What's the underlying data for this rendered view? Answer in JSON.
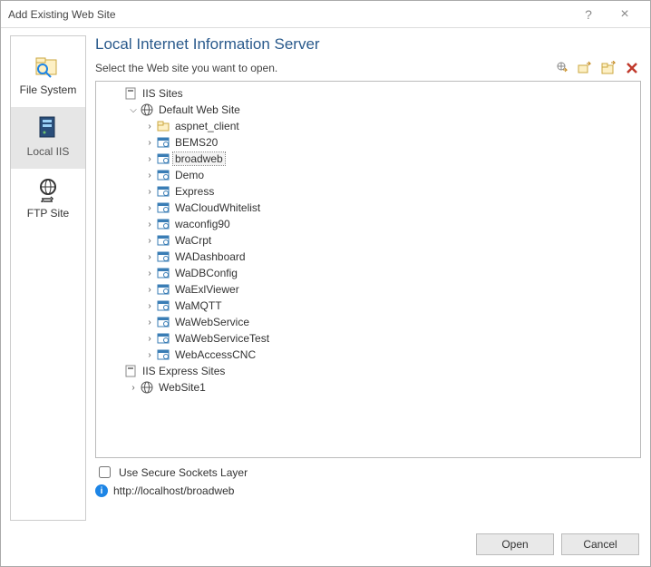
{
  "window": {
    "title": "Add Existing Web Site"
  },
  "sidebar": {
    "items": [
      {
        "label": "File System"
      },
      {
        "label": "Local IIS"
      },
      {
        "label": "FTP Site"
      }
    ]
  },
  "main": {
    "heading": "Local Internet Information Server",
    "subtext": "Select the Web site you want to open.",
    "tree": {
      "root1": "IIS Sites",
      "defaultSite": "Default Web Site",
      "children": [
        {
          "label": "aspnet_client",
          "type": "folder"
        },
        {
          "label": "BEMS20",
          "type": "app"
        },
        {
          "label": "broadweb",
          "type": "app",
          "selected": true
        },
        {
          "label": "Demo",
          "type": "app"
        },
        {
          "label": "Express",
          "type": "app"
        },
        {
          "label": "WaCloudWhitelist",
          "type": "app"
        },
        {
          "label": "waconfig90",
          "type": "app"
        },
        {
          "label": "WaCrpt",
          "type": "app"
        },
        {
          "label": "WADashboard",
          "type": "app"
        },
        {
          "label": "WaDBConfig",
          "type": "app"
        },
        {
          "label": "WaExlViewer",
          "type": "app"
        },
        {
          "label": "WaMQTT",
          "type": "app"
        },
        {
          "label": "WaWebService",
          "type": "app"
        },
        {
          "label": "WaWebServiceTest",
          "type": "app"
        },
        {
          "label": "WebAccessCNC",
          "type": "app"
        }
      ],
      "root2": "IIS Express Sites",
      "expressChild": "WebSite1"
    },
    "ssl_label": "Use Secure Sockets Layer",
    "url": "http://localhost/broadweb"
  },
  "footer": {
    "open": "Open",
    "cancel": "Cancel"
  }
}
